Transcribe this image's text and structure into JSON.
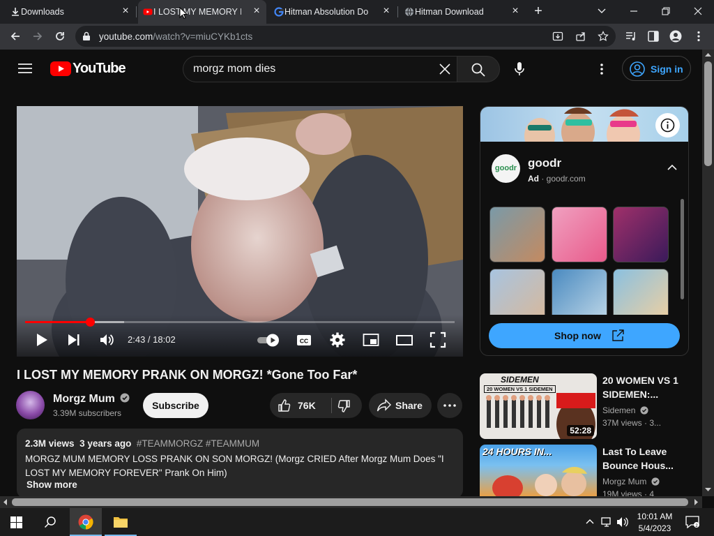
{
  "browser": {
    "tabs": [
      {
        "label": "Downloads",
        "icon": "download-icon",
        "active": false
      },
      {
        "label": "I LOST MY MEMORY PR",
        "icon": "youtube-icon",
        "active": true
      },
      {
        "label": "Hitman Absolution Do",
        "icon": "google-icon",
        "active": false
      },
      {
        "label": "Hitman Download",
        "icon": "globe-icon",
        "active": false
      }
    ],
    "new_tab": "+",
    "url_domain": "youtube.com",
    "url_path": "/watch?v=miuCYKb1cts"
  },
  "youtube": {
    "logo_text": "YouTube",
    "search_value": "morgz mom dies",
    "search_placeholder": "Search",
    "sign_in": "Sign in"
  },
  "player": {
    "current_time": "2:43",
    "duration": "18:02",
    "timecode": "2:43 / 18:02",
    "progress_fraction": 0.151,
    "buffered_fraction": 0.23,
    "autoplay": "on"
  },
  "video": {
    "title": "I LOST MY MEMORY PRANK ON MORGZ! *Gone Too Far*",
    "channel": "Morgz Mum",
    "subscribers": "3.39M subscribers",
    "subscribe_label": "Subscribe",
    "likes": "76K",
    "share_label": "Share",
    "views": "2.3M views",
    "age": "3 years ago",
    "tags": "#TEAMMORGZ #TEAMMUM",
    "description": "MORGZ MUM MEMORY LOSS PRANK ON SON MORGZ! (Morgz CRIED After Morgz Mum Does \"I LOST MY MEMORY FOREVER\" Prank On Him)",
    "show_more": "Show more"
  },
  "ad": {
    "advertiser": "goodr",
    "logo_text": "goodr",
    "ad_label": "Ad",
    "domain": "goodr.com",
    "cta": "Shop now"
  },
  "recommendations": [
    {
      "title": "20 WOMEN VS 1 SIDEMEN:...",
      "channel": "Sidemen",
      "meta": "37M views · 3...",
      "duration": "52:28",
      "thumb_text": "20 WOMEN VS 1 SIDEMEN",
      "thumb_brand": "SIDEMEN"
    },
    {
      "title": "Last To Leave Bounce Hous...",
      "channel": "Morgz Mum",
      "meta": "19M views · 4",
      "duration": "",
      "thumb_text": "24 HOURS IN...",
      "thumb_brand": ""
    }
  ],
  "taskbar": {
    "time": "10:01 AM",
    "date": "5/4/2023"
  },
  "colors": {
    "youtube_red": "#ff0000",
    "accent_blue": "#3ea6ff",
    "background": "#0f0f0f"
  }
}
